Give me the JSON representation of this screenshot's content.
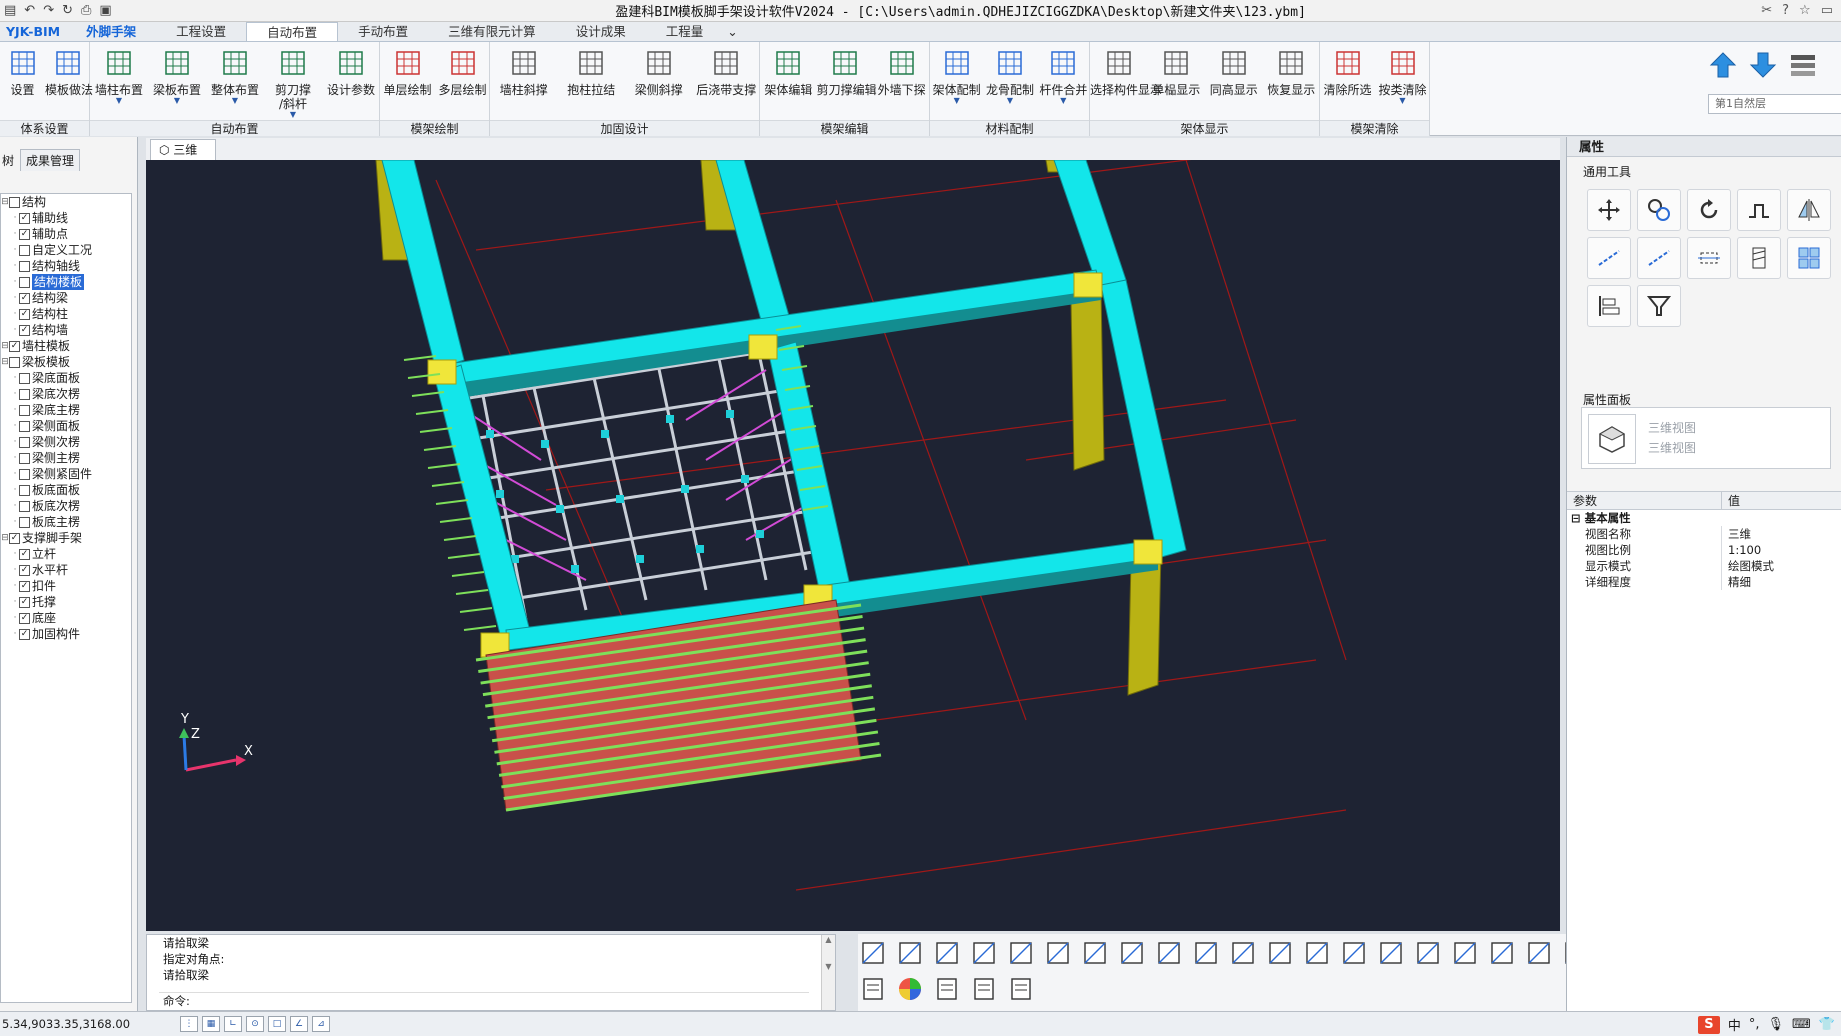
{
  "titlebar": {
    "title": "盈建科BIM模板脚手架设计软件V2024 - [C:\\Users\\admin.QDHEJIZCIGGZDKA\\Desktop\\新建文件夹\\123.ybm]",
    "qat_icons": [
      "open-icon",
      "undo-icon",
      "redo-icon",
      "refresh-icon",
      "print-icon",
      "export-icon"
    ],
    "right_icons": [
      "tools-icon",
      "help-icon",
      "star-icon",
      "window-icon"
    ]
  },
  "menu": {
    "tabs": [
      "YJK-BIM",
      "外脚手架",
      "工程设置",
      "自动布置",
      "手动布置",
      "三维有限元计算",
      "设计成果",
      "工程量"
    ],
    "active_index": 3
  },
  "ribbon": {
    "groups": [
      {
        "label": "体系设置",
        "buttons": [
          {
            "label": "设置"
          },
          {
            "label": "模板做法"
          }
        ]
      },
      {
        "label": "自动布置",
        "buttons": [
          {
            "label": "墙柱布置",
            "arrow": true
          },
          {
            "label": "梁板布置",
            "arrow": true
          },
          {
            "label": "整体布置",
            "arrow": true
          },
          {
            "label": "剪刀撑",
            "label2": "/斜杆",
            "arrow": true
          },
          {
            "label": "设计参数"
          }
        ]
      },
      {
        "label": "模架绘制",
        "buttons": [
          {
            "label": "单层绘制"
          },
          {
            "label": "多层绘制"
          }
        ]
      },
      {
        "label": "加固设计",
        "buttons": [
          {
            "label": "墙柱斜撑"
          },
          {
            "label": "抱柱拉结"
          },
          {
            "label": "梁侧斜撑"
          },
          {
            "label": "后浇带支撑"
          }
        ]
      },
      {
        "label": "模架编辑",
        "buttons": [
          {
            "label": "架体编辑"
          },
          {
            "label": "剪刀撑编辑"
          },
          {
            "label": "外墙下探"
          }
        ]
      },
      {
        "label": "材料配制",
        "buttons": [
          {
            "label": "架体配制",
            "arrow": true
          },
          {
            "label": "龙骨配制",
            "arrow": true
          },
          {
            "label": "杆件合并",
            "arrow": true
          }
        ]
      },
      {
        "label": "架体显示",
        "buttons": [
          {
            "label": "选择构件显示"
          },
          {
            "label": "单榀显示"
          },
          {
            "label": "同高显示"
          },
          {
            "label": "恢复显示"
          }
        ]
      },
      {
        "label": "模架清除",
        "buttons": [
          {
            "label": "清除所选"
          },
          {
            "label": "按类清除",
            "arrow": true
          }
        ]
      }
    ],
    "layer_value": "第1自然层"
  },
  "left_panel": {
    "tabs": [
      "树",
      "成果管理"
    ],
    "tree": [
      {
        "label": "结构",
        "level": 0,
        "checked": false
      },
      {
        "label": "辅助线",
        "level": 1,
        "checked": true
      },
      {
        "label": "辅助点",
        "level": 1,
        "checked": true
      },
      {
        "label": "自定义工况",
        "level": 1,
        "checked": false
      },
      {
        "label": "结构轴线",
        "level": 1,
        "checked": false
      },
      {
        "label": "结构楼板",
        "level": 1,
        "checked": false,
        "selected": true
      },
      {
        "label": "结构梁",
        "level": 1,
        "checked": true
      },
      {
        "label": "结构柱",
        "level": 1,
        "checked": true
      },
      {
        "label": "结构墙",
        "level": 1,
        "checked": true
      },
      {
        "label": "墙柱模板",
        "level": 0,
        "checked": true
      },
      {
        "label": "梁板模板",
        "level": 0,
        "checked": false
      },
      {
        "label": "梁底面板",
        "level": 1,
        "checked": false
      },
      {
        "label": "梁底次楞",
        "level": 1,
        "checked": false
      },
      {
        "label": "梁底主楞",
        "level": 1,
        "checked": false
      },
      {
        "label": "梁侧面板",
        "level": 1,
        "checked": false
      },
      {
        "label": "梁侧次楞",
        "level": 1,
        "checked": false
      },
      {
        "label": "梁侧主楞",
        "level": 1,
        "checked": false
      },
      {
        "label": "梁侧紧固件",
        "level": 1,
        "checked": false
      },
      {
        "label": "板底面板",
        "level": 1,
        "checked": false
      },
      {
        "label": "板底次楞",
        "level": 1,
        "checked": false
      },
      {
        "label": "板底主楞",
        "level": 1,
        "checked": false
      },
      {
        "label": "支撑脚手架",
        "level": 0,
        "checked": true
      },
      {
        "label": "立杆",
        "level": 1,
        "checked": true
      },
      {
        "label": "水平杆",
        "level": 1,
        "checked": true
      },
      {
        "label": "扣件",
        "level": 1,
        "checked": true
      },
      {
        "label": "托撑",
        "level": 1,
        "checked": true
      },
      {
        "label": "底座",
        "level": 1,
        "checked": true
      },
      {
        "label": "加固构件",
        "level": 1,
        "checked": true
      }
    ]
  },
  "viewport": {
    "tab_label": "三维",
    "axes": {
      "y": "Y",
      "z": "Z",
      "x": "X"
    }
  },
  "command": {
    "history": [
      "请拾取梁",
      "指定对角点:",
      "请拾取梁"
    ],
    "prompt": "命令:"
  },
  "right_panel": {
    "title": "属性",
    "tools_label": "通用工具",
    "props_label": "属性面板",
    "view_names": [
      "三维视图",
      "三维视图"
    ],
    "table_headers": [
      "参数",
      "值"
    ],
    "group": "基本属性",
    "rows": [
      {
        "k": "视图名称",
        "v": "三维"
      },
      {
        "k": "视图比例",
        "v": "1:100"
      },
      {
        "k": "显示模式",
        "v": "绘图模式"
      },
      {
        "k": "详细程度",
        "v": "精细"
      }
    ]
  },
  "status": {
    "coords": "5.34,9033.35,3168.00",
    "ime": "S",
    "ime_lang": "中"
  },
  "colors": {
    "viewport_bg": "#1e2333",
    "beam": "#13e6ea",
    "column": "#b9b214",
    "scaffold_green": "#7ee05a",
    "formwork_red": "#c9504a"
  }
}
